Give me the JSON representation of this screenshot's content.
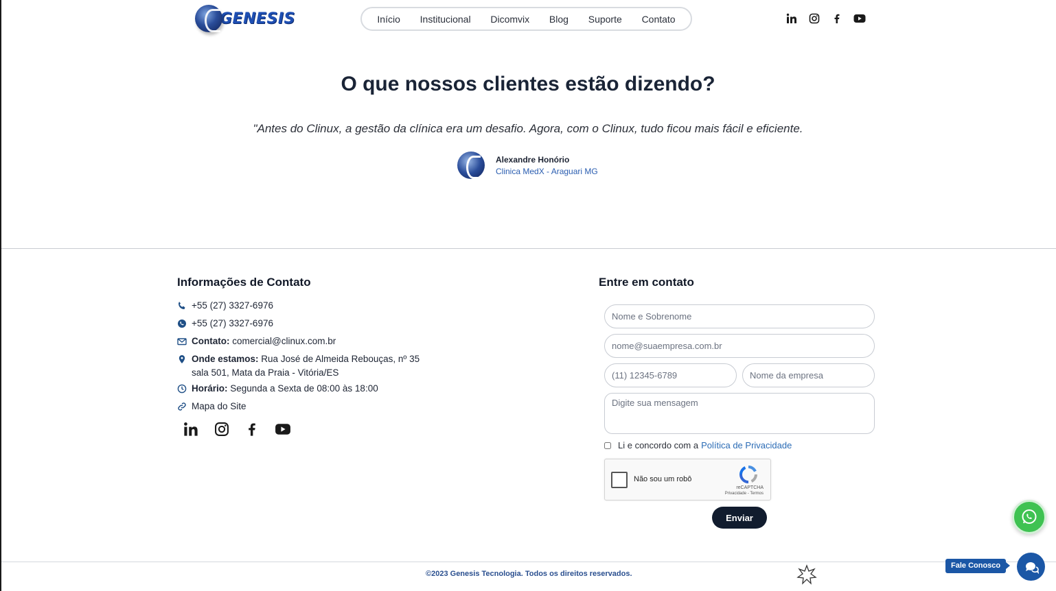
{
  "header": {
    "logo_text": "GENESIS",
    "nav": [
      "Início",
      "Institucional",
      "Dicomvix",
      "Blog",
      "Suporte",
      "Contato"
    ],
    "social": [
      "linkedin-icon",
      "instagram-icon",
      "facebook-icon",
      "youtube-icon"
    ]
  },
  "testimonial": {
    "title": "O que nossos clientes estão dizendo?",
    "quote": "\"Antes do Clinux, a gestão da clínica era um desafio. Agora, com o Clinux, tudo ficou mais fácil e eficiente.",
    "author_name": "Alexandre Honório",
    "author_company": "Clinica MedX - Araguari MG"
  },
  "contact_info": {
    "title": "Informações de Contato",
    "phone": "+55 (27) 3327-6976",
    "whatsapp": "+55 (27) 3327-6976",
    "email_label": "Contato:",
    "email": "comercial@clinux.com.br",
    "address_label": "Onde estamos:",
    "address": "Rua José de Almeida Rebouças, nº 35 sala 501, Mata da Praia - Vitória/ES",
    "hours_label": "Horário:",
    "hours": "Segunda a Sexta de 08:00 às 18:00",
    "sitemap": "Mapa do Site"
  },
  "form": {
    "title": "Entre em contato",
    "name_placeholder": "Nome e Sobrenome",
    "email_placeholder": "nome@suaempresa.com.br",
    "phone_placeholder": "(11) 12345-6789",
    "company_placeholder": "Nome da empresa",
    "message_placeholder": "Digite sua mensagem",
    "consent_text": "Li e concordo com a",
    "consent_link": "Política de Privacidade",
    "captcha_label": "Não sou um robô",
    "captcha_brand": "reCAPTCHA",
    "captcha_terms": "Privacidade - Termos",
    "submit_label": "Enviar"
  },
  "footer": {
    "copyright": "©2023 Genesis Tecnologia. Todos os direitos reservados."
  },
  "floating": {
    "chat_label": "Fale Conosco"
  },
  "colors": {
    "primary_dark": "#111c2e",
    "link_blue": "#2a6bb5",
    "whatsapp_green": "#3fc252",
    "chat_blue": "#1b57a6"
  }
}
